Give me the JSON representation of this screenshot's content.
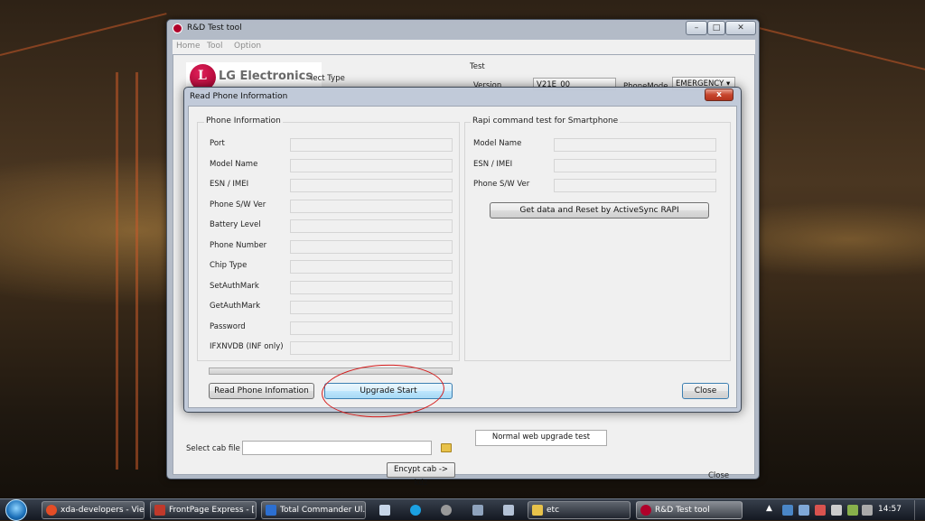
{
  "main_window": {
    "title": "R&D Test tool",
    "controls": {
      "minimize": "–",
      "maximize": "□",
      "close": "✕"
    },
    "menu": [
      "Home",
      "Tool",
      "Option"
    ],
    "logo_text": "LG Electronics",
    "select_type_label": "lect Type",
    "test_group_label": "Test",
    "version_label": "Version",
    "version_value": "V21E_00",
    "phone_mode_label": "PhoneMode",
    "phone_mode_value": "EMERGENCY",
    "normal_web_upgrade": "Normal web upgrade test",
    "select_cab_label": "Select cab file",
    "encrypt_button": "Encypt cab -> kdz",
    "close_label": "Close"
  },
  "dialog": {
    "title": "Read Phone Information",
    "close_glyph": "x",
    "phone_info_title": "Phone Information",
    "phone_fields": [
      "Port",
      "Model Name",
      "ESN / IMEI",
      "Phone S/W Ver",
      "Battery Level",
      "Phone Number",
      "Chip Type",
      "SetAuthMark",
      "GetAuthMark",
      "Password",
      "IFXNVDB (INF only)"
    ],
    "rapi_title": "Rapi command test for Smartphone",
    "rapi_fields": [
      "Model Name",
      "ESN / IMEI",
      "Phone S/W Ver"
    ],
    "rapi_button": "Get data and Reset by ActiveSync RAPI",
    "read_button": "Read Phone Infomation",
    "upgrade_button": "Upgrade Start",
    "close_button": "Close",
    "progress_fraction": 0
  },
  "taskbar": {
    "items": [
      {
        "label": "xda-developers - Vie...",
        "icon_color": "#e44d26"
      },
      {
        "label": "FrontPage Express - [...",
        "icon_color": "#c0392b"
      },
      {
        "label": "Total Commander Ul...",
        "icon_color": "#2c6fd1"
      },
      {
        "label": "etc",
        "icon_color": "#e8c24a"
      },
      {
        "label": "R&D Test tool",
        "icon_color": "#b0002a"
      }
    ],
    "clock": "14:57"
  },
  "colors": {
    "accent_lg": "#a3002d",
    "highlight_circle": "#d41a1a",
    "button_hover": "#a7d9f5"
  }
}
